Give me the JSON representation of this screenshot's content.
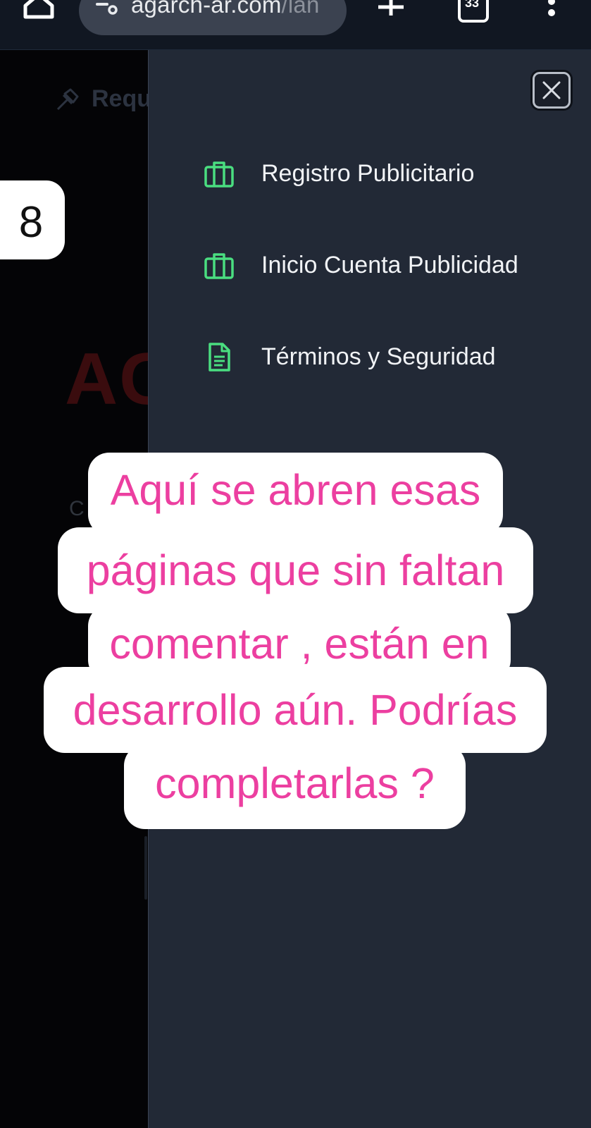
{
  "browser": {
    "url_host": "agarch-ar.com",
    "url_path": "/lan",
    "tab_count": "33",
    "icons": {
      "home": "home-icon",
      "site_info": "tune-icon",
      "new_tab": "plus-icon",
      "tabs": "tabs-icon",
      "menu": "kebab-menu-icon"
    }
  },
  "background_page": {
    "request_label": "Reque",
    "logo_text": "AG",
    "stray_letter": "C"
  },
  "drawer": {
    "close_icon": "close-icon",
    "accent_color": "#4ade80",
    "items": [
      {
        "label": "Registro Publicitario",
        "icon": "briefcase-icon"
      },
      {
        "label": "Inicio Cuenta Publicidad",
        "icon": "briefcase-icon"
      },
      {
        "label": "Términos y Seguridad",
        "icon": "document-icon"
      }
    ]
  },
  "annotation": {
    "step_number": "8",
    "text_color": "#ec3fa0",
    "lines": [
      "Aquí se abren esas",
      "páginas que sin faltan",
      "comentar , están en",
      "desarrollo aún. Podrías",
      "completarlas ?"
    ]
  }
}
